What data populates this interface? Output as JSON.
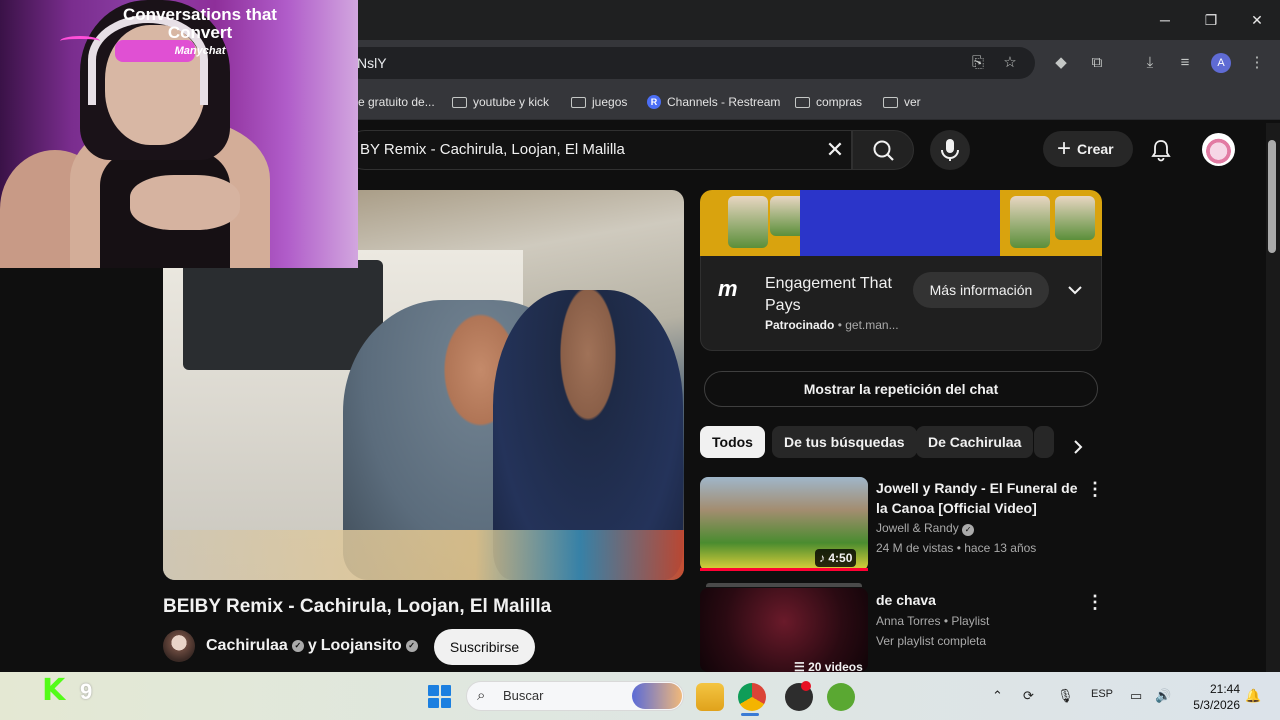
{
  "window": {
    "minimize": "─",
    "maximize": "❐",
    "close": "✕"
  },
  "omnibox": {
    "url": "NslY"
  },
  "bookmarks": [
    {
      "label": "e gratuito de...",
      "kind": "page"
    },
    {
      "label": "youtube y kick",
      "kind": "folder"
    },
    {
      "label": "juegos",
      "kind": "folder"
    },
    {
      "label": "Channels - Restream",
      "kind": "site",
      "badge": "R"
    },
    {
      "label": "compras",
      "kind": "folder"
    },
    {
      "label": "ver",
      "kind": "folder"
    }
  ],
  "profile_initial": "A",
  "youtube": {
    "search_query": "BY Remix - Cachirula, Loojan, El Malilla",
    "create_label": "Crear"
  },
  "video": {
    "title": "BEIBY Remix - Cachirula, Loojan, El Malilla",
    "channel_a": "Cachirulaa",
    "joiner": "y",
    "channel_b": "Loojansito",
    "subscribe_label": "Suscribirse"
  },
  "ad": {
    "banner_headline": "Conversations that Convert",
    "banner_brand": "Manychat",
    "logo_text": "m",
    "title": "Engagement That Pays",
    "sponsored_label": "Patrocinado",
    "domain": "get.man...",
    "cta_label": "Más información"
  },
  "chat_replay_label": "Mostrar la repetición del chat",
  "chips": [
    "Todos",
    "De tus búsquedas",
    "De Cachirulaa"
  ],
  "related": [
    {
      "title": "Jowell y Randy - El Funeral de la Canoa [Official Video]",
      "channel": "Jowell & Randy",
      "meta": "24 M de vistas • hace 13 años",
      "duration": "4:50"
    },
    {
      "title": "de chava",
      "channel": "Anna Torres • Playlist",
      "meta": "Ver playlist completa",
      "count": "20 videos"
    }
  ],
  "taskbar": {
    "kick_letter": "K",
    "kick_count": "9",
    "search_placeholder": "Buscar",
    "lang": "ESP",
    "time": "21:44",
    "date": "5/3/2026"
  },
  "colors": {
    "accent_red": "#ff0033",
    "kick_green": "#53fc18",
    "background": "#0f0f0f"
  }
}
